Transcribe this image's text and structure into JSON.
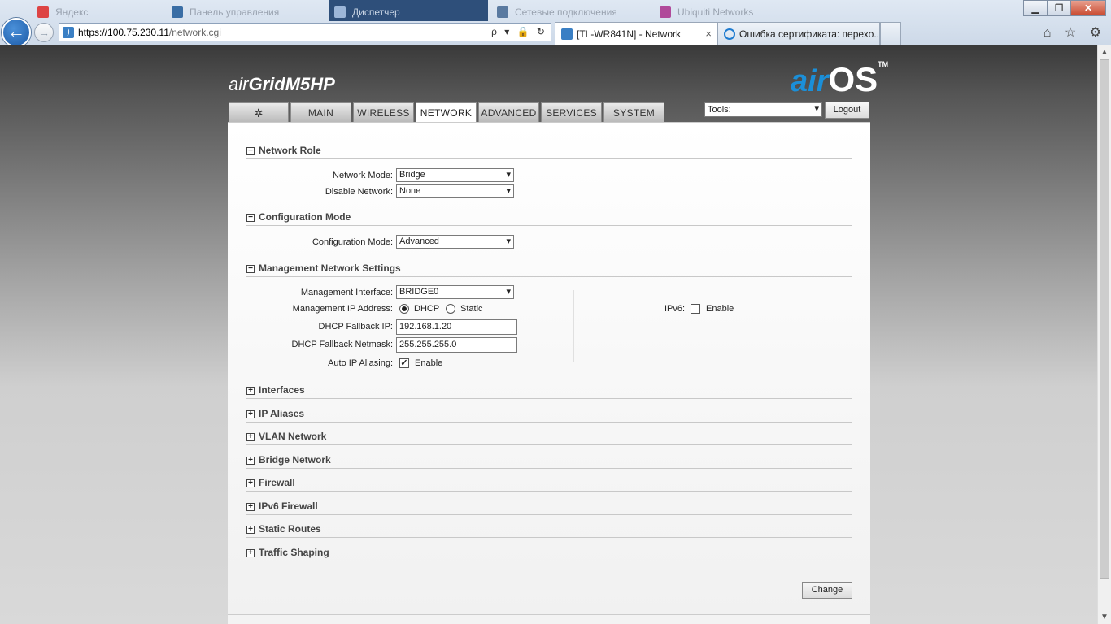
{
  "browser": {
    "background_tabs": [
      {
        "label": "Яндекс",
        "color": "#d44"
      },
      {
        "label": "Панель управления",
        "color": "#3a6ea5"
      },
      {
        "label": "Диспетчер",
        "color": "#3a6ea5"
      },
      {
        "label": "Сетевые подключения",
        "color": "#5a7aa0"
      },
      {
        "label": "Ubiquiti Networks",
        "color": "#b04a9a"
      }
    ],
    "window_controls": {
      "minimize": "▁",
      "restore": "❐",
      "close": "✕"
    },
    "back_arrow": "←",
    "forward_arrow": "→",
    "address": {
      "url_host": "https://100.75.230.11",
      "url_path": "/network.cgi",
      "icons": "ρ ▾ 🔒 ↻"
    },
    "tabs": [
      {
        "label": "[TL-WR841N] - Network",
        "active": true,
        "close": "×"
      },
      {
        "label": "Ошибка сертификата: перехо...",
        "active": false
      }
    ],
    "right_icons": "⌂ ☆ ⚙"
  },
  "brand": {
    "left_a": "air",
    "left_b": "Grid",
    "left_c": "M5HP",
    "right_air": "air",
    "right_os": "OS",
    "right_tm": "TM"
  },
  "nav": {
    "logo_tab": "✲",
    "tabs": [
      "MAIN",
      "WIRELESS",
      "NETWORK",
      "ADVANCED",
      "SERVICES",
      "SYSTEM"
    ],
    "active": "NETWORK",
    "tools_value": "Tools:",
    "logout_label": "Logout"
  },
  "sections": {
    "network_role": "Network Role",
    "configuration_mode": "Configuration Mode",
    "management": "Management Network Settings",
    "collapsed": [
      "Interfaces",
      "IP Aliases",
      "VLAN Network",
      "Bridge Network",
      "Firewall",
      "IPv6 Firewall",
      "Static Routes",
      "Traffic Shaping"
    ]
  },
  "expand_symbols": {
    "minus": "−",
    "plus": "+"
  },
  "fields": {
    "network_mode": {
      "label": "Network Mode:",
      "value": "Bridge"
    },
    "disable_network": {
      "label": "Disable Network:",
      "value": "None"
    },
    "configuration_mode": {
      "label": "Configuration Mode:",
      "value": "Advanced"
    },
    "management_interface": {
      "label": "Management Interface:",
      "value": "BRIDGE0"
    },
    "management_ip": {
      "label": "Management IP Address:",
      "opt_dhcp": "DHCP",
      "opt_static": "Static"
    },
    "dhcp_fallback_ip": {
      "label": "DHCP Fallback IP:",
      "value": "192.168.1.20"
    },
    "dhcp_fallback_netmask": {
      "label": "DHCP Fallback Netmask:",
      "value": "255.255.255.0"
    },
    "auto_ip_aliasing": {
      "label": "Auto IP Aliasing:",
      "option": "Enable",
      "check": "✓"
    },
    "ipv6": {
      "label": "IPv6:",
      "option": "Enable"
    }
  },
  "caret": "▾",
  "change_label": "Change",
  "scroll": {
    "up": "▲",
    "down": "▼"
  }
}
